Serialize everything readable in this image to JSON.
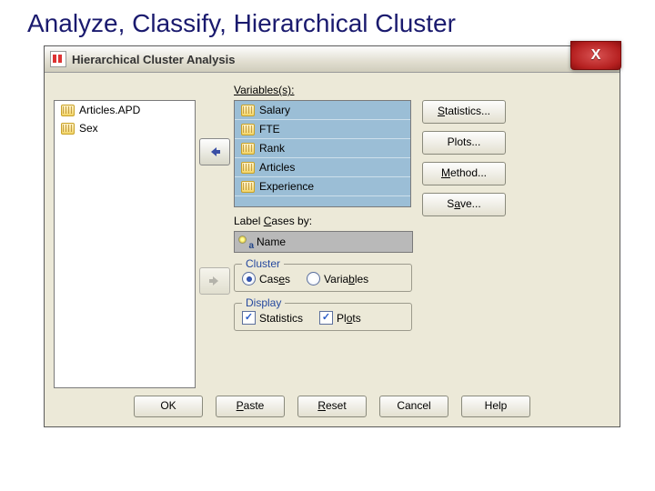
{
  "slide_title": "Analyze, Classify, Hierarchical Cluster",
  "window": {
    "title": "Hierarchical Cluster Analysis",
    "close_label": "X"
  },
  "available_vars": [
    {
      "name": "Articles.APD",
      "icon": "scale"
    },
    {
      "name": "Sex",
      "icon": "scale"
    }
  ],
  "sections": {
    "variables_label_pre": "",
    "variables_label": "Variables(s):",
    "label_cases_pre": "Label ",
    "label_cases_mid": "C",
    "label_cases_post": "ases by:"
  },
  "selected_vars": [
    {
      "name": "Salary",
      "icon": "scale"
    },
    {
      "name": "FTE",
      "icon": "scale"
    },
    {
      "name": "Rank",
      "icon": "scale"
    },
    {
      "name": "Articles",
      "icon": "scale"
    },
    {
      "name": "Experience",
      "icon": "scale"
    }
  ],
  "label_case_var": "Name",
  "cluster": {
    "group_title": "Cluster",
    "cases_pre": "Cas",
    "cases_u": "e",
    "cases_post": "s",
    "vars_pre": "Varia",
    "vars_u": "b",
    "vars_post": "les",
    "selected": "cases"
  },
  "display": {
    "group_title": "Display",
    "stats_label": "Statistics",
    "plots_pre": "Pl",
    "plots_u": "o",
    "plots_post": "ts",
    "stats_checked": true,
    "plots_checked": true
  },
  "side_buttons": {
    "statistics_u": "S",
    "statistics_post": "tatistics...",
    "plots": "Plots...",
    "method_u": "M",
    "method_post": "ethod...",
    "save_pre": "S",
    "save_u": "a",
    "save_post": "ve..."
  },
  "bottom": {
    "ok": "OK",
    "paste_u": "P",
    "paste_post": "aste",
    "reset_u": "R",
    "reset_post": "eset",
    "cancel": "Cancel",
    "help": "Help"
  }
}
